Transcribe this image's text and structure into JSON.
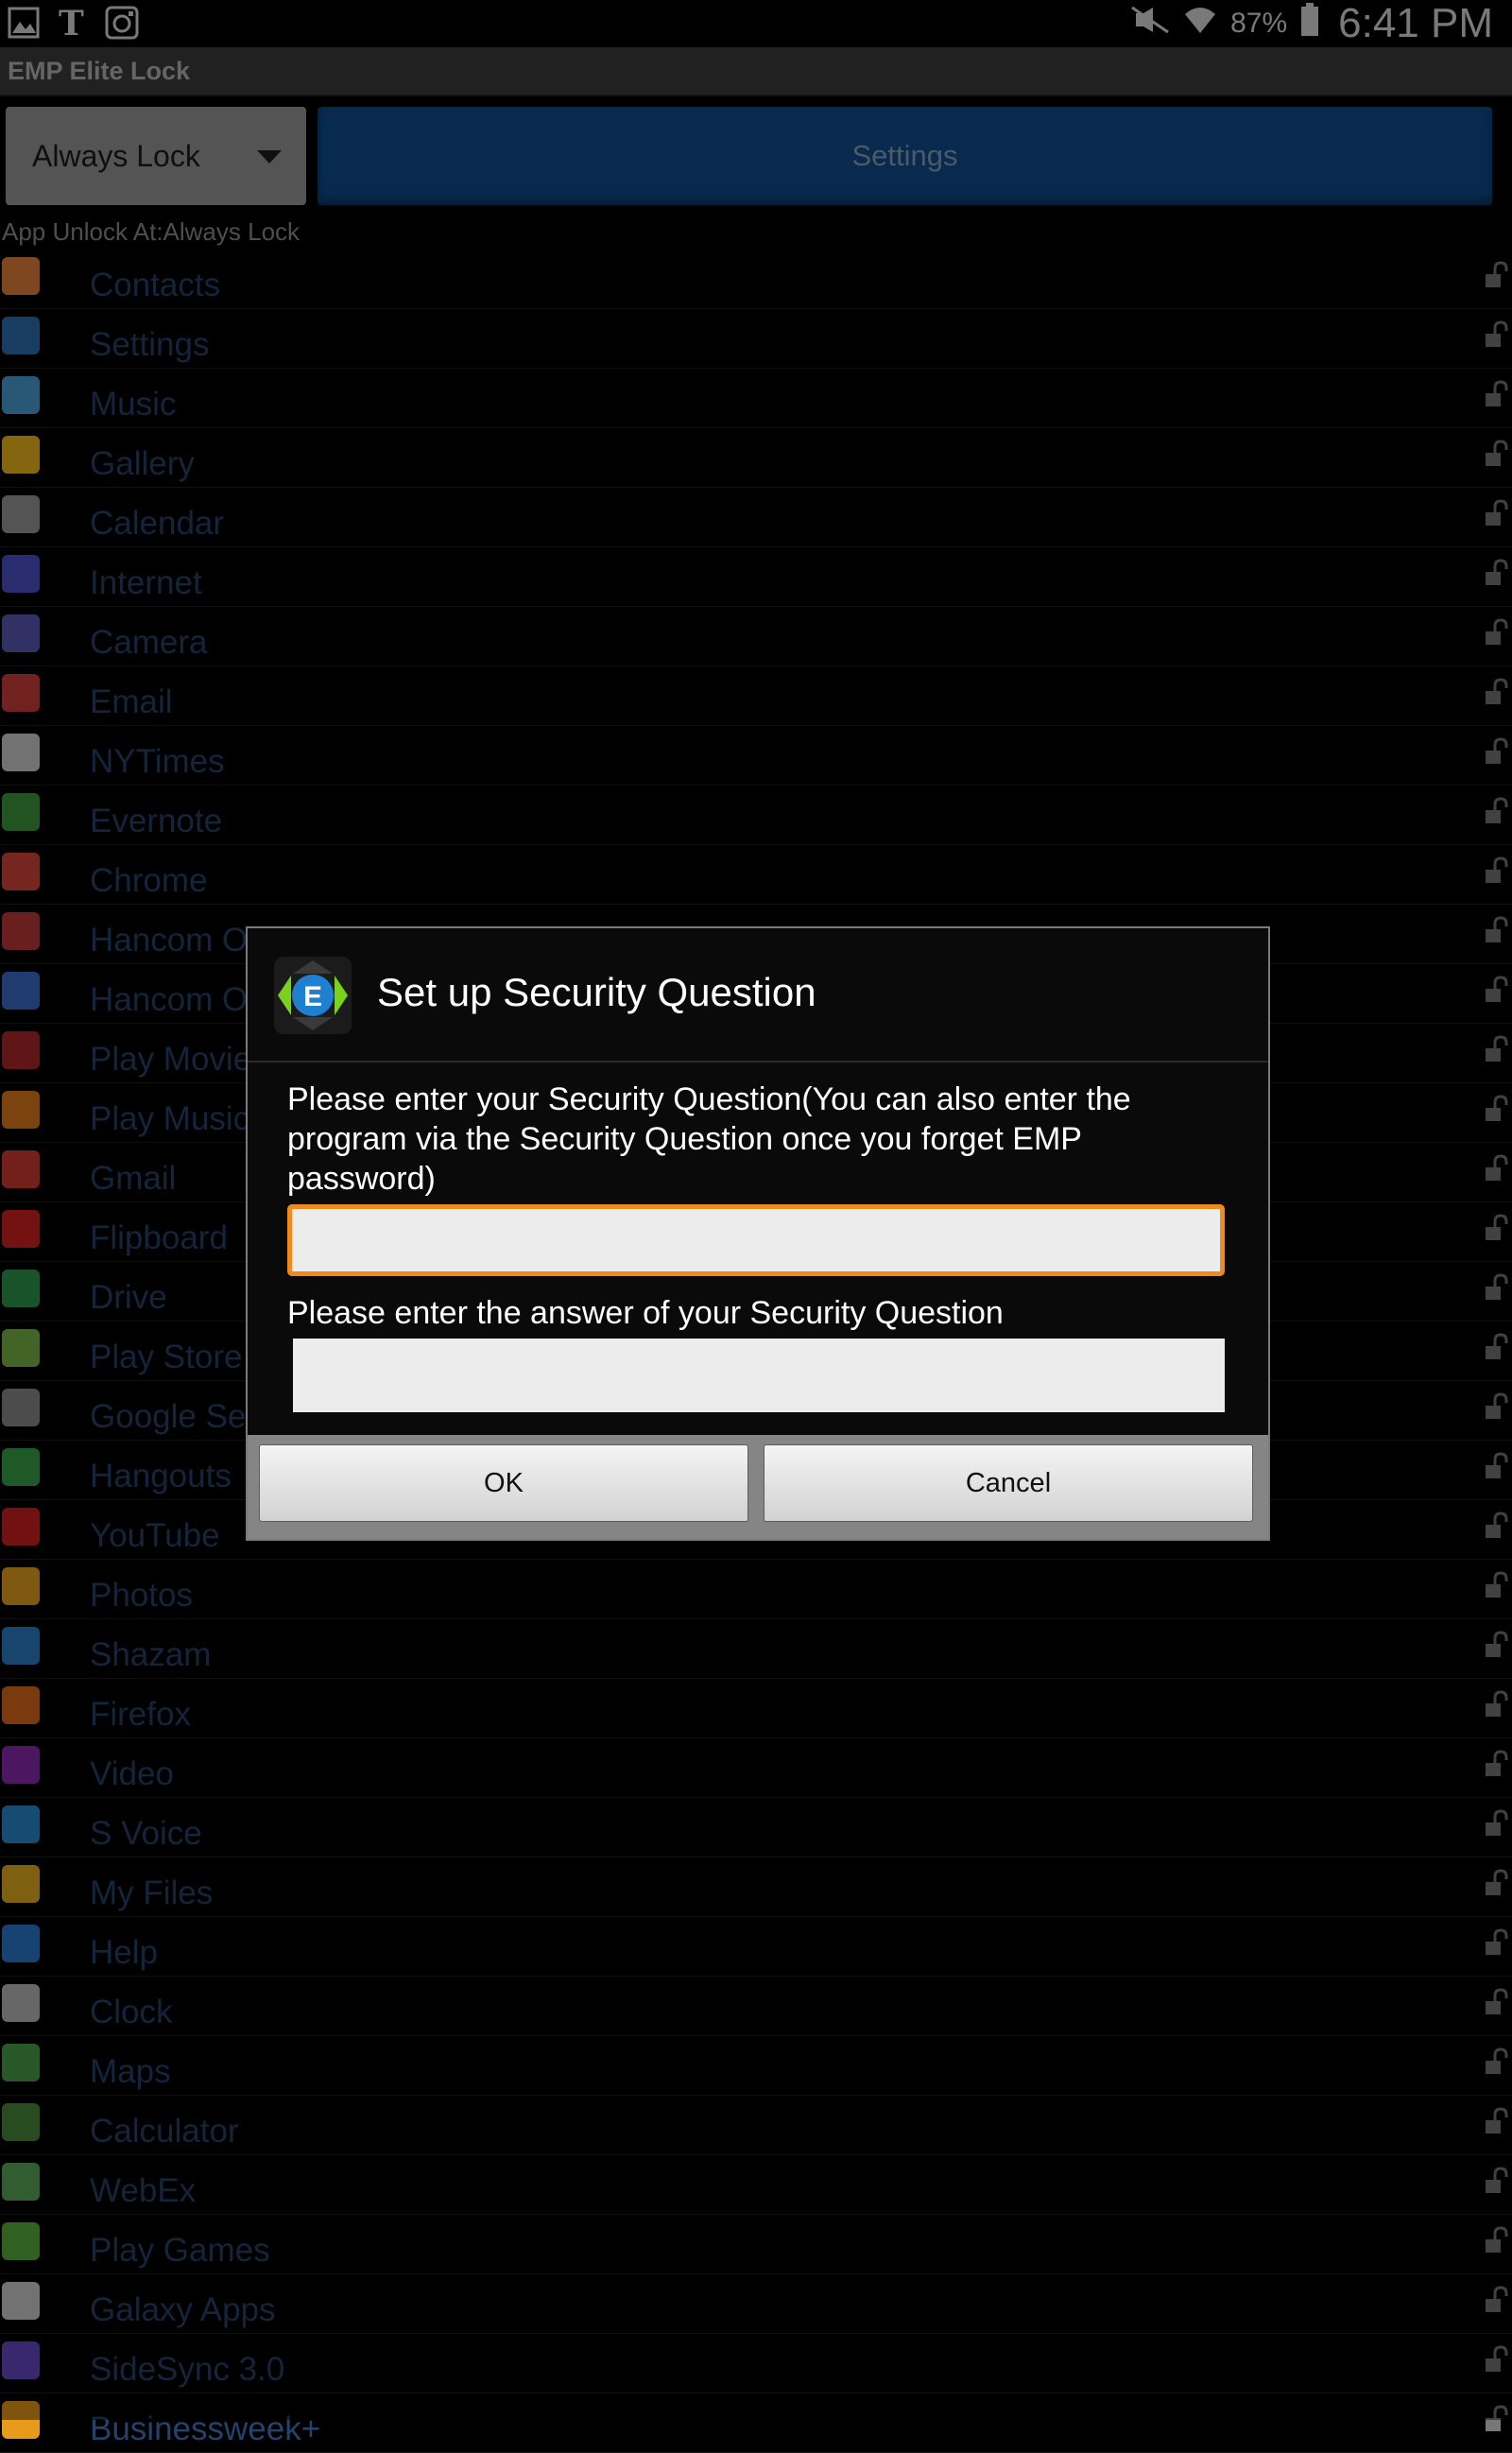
{
  "status_bar": {
    "battery": "87%",
    "time": "6:41 PM"
  },
  "app_title": "EMP Elite Lock",
  "toolbar": {
    "mode_select": "Always Lock",
    "settings_label": "Settings"
  },
  "unlock_info": "App Unlock At:Always Lock",
  "apps": [
    {
      "name": "Contacts",
      "color": "#e8823a"
    },
    {
      "name": "Settings",
      "color": "#2f6fb0"
    },
    {
      "name": "Music",
      "color": "#4aa0d8"
    },
    {
      "name": "Gallery",
      "color": "#f0b81e"
    },
    {
      "name": "Calendar",
      "color": "#9a9a9a"
    },
    {
      "name": "Internet",
      "color": "#4b50c8"
    },
    {
      "name": "Camera",
      "color": "#5a5ab8"
    },
    {
      "name": "Email",
      "color": "#d03c3c"
    },
    {
      "name": "NYTimes",
      "color": "#cfcfcf"
    },
    {
      "name": "Evernote",
      "color": "#3f9a3f"
    },
    {
      "name": "Chrome",
      "color": "#d8453a"
    },
    {
      "name": "Hancom Office Updater",
      "color": "#c23a3a"
    },
    {
      "name": "Hancom Office",
      "color": "#3b6ec8"
    },
    {
      "name": "Play Movies",
      "color": "#b02828"
    },
    {
      "name": "Play Music",
      "color": "#e07a1a"
    },
    {
      "name": "Gmail",
      "color": "#d23a30"
    },
    {
      "name": "Flipboard",
      "color": "#d42020"
    },
    {
      "name": "Drive",
      "color": "#2f9a4a"
    },
    {
      "name": "Play Store",
      "color": "#7ab648"
    },
    {
      "name": "Google Settings",
      "color": "#8a8a8a"
    },
    {
      "name": "Hangouts",
      "color": "#3aa24a"
    },
    {
      "name": "YouTube",
      "color": "#d02020"
    },
    {
      "name": "Photos",
      "color": "#e8a020"
    },
    {
      "name": "Shazam",
      "color": "#2d7ec8"
    },
    {
      "name": "Firefox",
      "color": "#e06a1a"
    },
    {
      "name": "Video",
      "color": "#8a2ab0"
    },
    {
      "name": "S Voice",
      "color": "#2a8ad0"
    },
    {
      "name": "My Files",
      "color": "#e8b020"
    },
    {
      "name": "Help",
      "color": "#2a7ad0"
    },
    {
      "name": "Clock",
      "color": "#bcbcbc"
    },
    {
      "name": "Maps",
      "color": "#4aa04a"
    },
    {
      "name": "Calculator",
      "color": "#4a8a3a"
    },
    {
      "name": "WebEx",
      "color": "#5aaa5a"
    },
    {
      "name": "Play Games",
      "color": "#5ab040"
    },
    {
      "name": "Galaxy Apps",
      "color": "#d0d0d0"
    },
    {
      "name": "SideSync 3.0",
      "color": "#6a4ac8"
    },
    {
      "name": "Businessweek+",
      "color": "#e89a1a"
    }
  ],
  "dialog": {
    "title": "Set up Security Question",
    "question_label": "Please enter your Security Question(You can also enter the program via the Security Question once you forget EMP password)",
    "question_value": "",
    "answer_label": "Please enter the answer of your Security Question",
    "answer_value": "",
    "ok_label": "OK",
    "cancel_label": "Cancel",
    "logo_letter": "E"
  }
}
